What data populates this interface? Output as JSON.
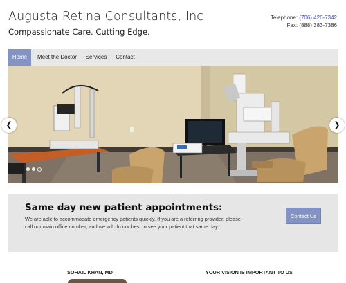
{
  "header": {
    "title": "Augusta Retina Consultants, Inc",
    "tagline": "Compassionate Care. Cutting Edge.",
    "telephone_label": "Telephone:",
    "telephone": "(706) 426-7342",
    "fax": "Fax: (888) 383-7386"
  },
  "nav": {
    "items": [
      {
        "label": "Home",
        "active": true
      },
      {
        "label": "Meet the Doctor",
        "active": false
      },
      {
        "label": "Services",
        "active": false
      },
      {
        "label": "Contact",
        "active": false
      }
    ]
  },
  "slider": {
    "prev_icon": "chevron-left-icon",
    "next_icon": "chevron-right-icon",
    "slide_count": 3,
    "active_slide": 3
  },
  "appointment": {
    "title": "Same day new patient appointments:",
    "text": "We are able to accommodate emergency patients quickly. If you are a referring provider, please call our main office number, and we will do our best to see your patient that same day.",
    "button_label": "Contact Us"
  },
  "footer": {
    "doctor_heading": "SOHAIL KHAN, MD",
    "vision_heading": "YOUR VISION IS IMPORTANT TO US"
  },
  "colors": {
    "accent": "#8393c3",
    "nav_background": "#e8e8e8",
    "panel_background": "#e6e6e6"
  }
}
